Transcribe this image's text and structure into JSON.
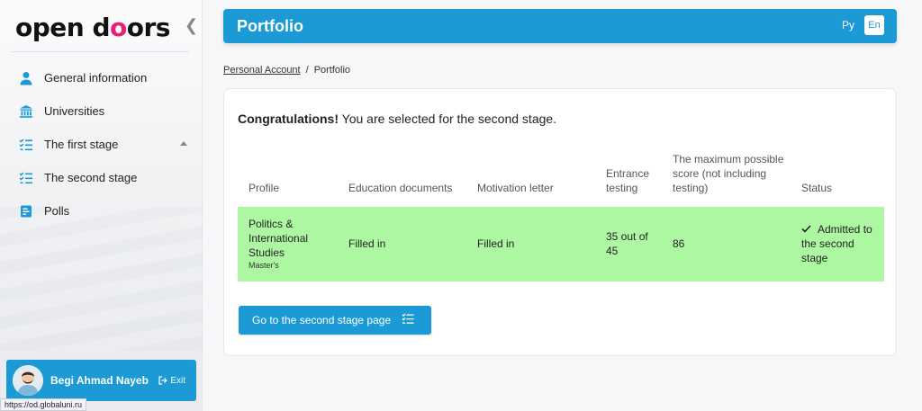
{
  "sidebar": {
    "logo": {
      "part1": "open d",
      "part2": "o",
      "part3": "ors"
    },
    "collapse_icon": "chevron-left-double",
    "items": [
      {
        "label": "General information",
        "icon": "user-icon"
      },
      {
        "label": "Universities",
        "icon": "university-icon"
      },
      {
        "label": "The first stage",
        "icon": "checklist-icon",
        "expanded": true
      },
      {
        "label": "The second stage",
        "icon": "checklist-icon"
      },
      {
        "label": "Polls",
        "icon": "poll-icon"
      }
    ],
    "user": {
      "name": "Begi Ahmad Nayeb",
      "exit_label": "Exit"
    }
  },
  "status_url": "https://od.globaluni.ru",
  "header": {
    "title": "Portfolio",
    "lang_ru": "Ру",
    "lang_en": "En"
  },
  "breadcrumb": {
    "home": "Personal Account",
    "separator": "/",
    "current": "Portfolio"
  },
  "card": {
    "congrats_bold": "Congratulations!",
    "congrats_text": " You are selected for the second stage.",
    "columns": {
      "profile": "Profile",
      "education": "Education documents",
      "motivation": "Motivation letter",
      "testing_1": "Entrance",
      "testing_2": "testing",
      "max_1": "The maximum possible",
      "max_2": "score (not including",
      "max_3": "testing)",
      "status": "Status"
    },
    "row": {
      "profile_1": "Politics &",
      "profile_2": "International",
      "profile_3": "Studies",
      "degree": "Master's",
      "education": "Filled in",
      "motivation": "Filled in",
      "testing_1": "35 out of",
      "testing_2": "45",
      "max_score": "86",
      "status_1": "Admitted to",
      "status_2": "the second",
      "status_3": "stage"
    },
    "button_label": "Go to the second stage page"
  },
  "colors": {
    "accent": "#1b9ad5",
    "row_highlight": "#adf7a2",
    "logo_pink": "#e5217a"
  }
}
